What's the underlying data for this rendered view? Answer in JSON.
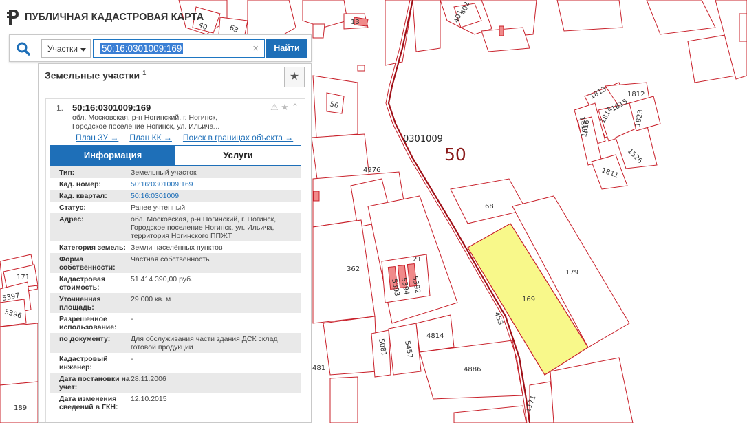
{
  "header": {
    "title": "ПУБЛИЧНАЯ КАДАСТРОВАЯ КАРТА"
  },
  "search": {
    "type_label": "Участки",
    "query": "50:16:0301009:169",
    "clear_glyph": "×",
    "button_label": "Найти"
  },
  "panel": {
    "title": "Земельные участки",
    "count": "1",
    "star_glyph": "★",
    "item": {
      "number": "1.",
      "cadastral_number": "50:16:0301009:169",
      "address_short": "обл. Московская, р-н Ногинский, г. Ногинск, Городское поселение Ногинск, ул. Ильича...",
      "icons": "⚠ ★ ⌃",
      "links": [
        "План ЗУ →",
        "План КК →",
        "Поиск в границах объекта →"
      ],
      "tabs": [
        "Информация",
        "Услуги"
      ],
      "attributes": [
        {
          "key": "Тип:",
          "value": "Земельный участок"
        },
        {
          "key": "Кад. номер:",
          "value": "50:16:0301009:169",
          "link": true
        },
        {
          "key": "Кад. квартал:",
          "value": "50:16:0301009",
          "link": true
        },
        {
          "key": "Статус:",
          "value": "Ранее учтенный"
        },
        {
          "key": "Адрес:",
          "value": "обл. Московская, р-н Ногинский, г. Ногинск, Городское поселение Ногинск, ул. Ильича, территория Ногинского ППЖТ"
        },
        {
          "key": "Категория земель:",
          "value": "Земли населённых пунктов"
        },
        {
          "key": "Форма собственности:",
          "value": "Частная собственность"
        },
        {
          "key": "Кадастровая стоимость:",
          "value": "51 414 390,00 руб."
        },
        {
          "key": "Уточненная площадь:",
          "value": "29 000 кв. м"
        },
        {
          "key": "Разрешенное использование:",
          "value": "-"
        },
        {
          "key": "по документу:",
          "value": "Для обслуживания части здания ДСК склад готовой продукции"
        },
        {
          "key": "Кадастровый инженер:",
          "value": "-"
        },
        {
          "key": "Дата постановки на учет:",
          "value": "28.11.2006"
        },
        {
          "key": "Дата изменения сведений в ГКН:",
          "value": "12.10.2015"
        }
      ]
    }
  },
  "map": {
    "region_label": "50",
    "quarter_label": "0301009",
    "highlight_color": "#f8f88a",
    "parcel_color": "#c8202a",
    "labels": [
      "13",
      "402",
      "401",
      "40",
      "63",
      "56",
      "4976",
      "68",
      "179",
      "169",
      "453",
      "362",
      "21",
      "5392",
      "5394",
      "5393",
      "4814",
      "5081",
      "5457",
      "4886",
      "481",
      "171",
      "5397",
      "5396",
      "189",
      "1813",
      "1812",
      "1815",
      "1817",
      "1814",
      "1816",
      "1823",
      "1526",
      "1811",
      "1171"
    ]
  }
}
